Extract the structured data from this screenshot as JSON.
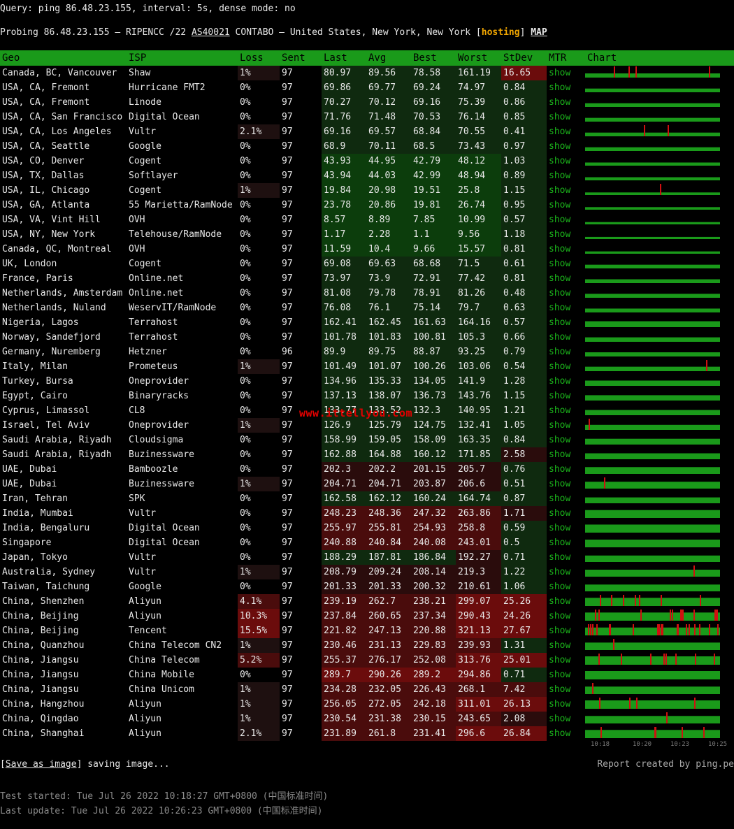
{
  "query_line": "Query: ping 86.48.23.155, interval: 5s, dense mode: no",
  "probe": {
    "prefix": "Probing 86.48.23.155 — RIPENCC /22 ",
    "asn": "AS40021",
    "middle": " CONTABO — United States, New York, New York [",
    "tag": "hosting",
    "end": "] ",
    "map": "MAP"
  },
  "headers": [
    "Geo",
    "ISP",
    "Loss",
    "Sent",
    "Last",
    "Avg",
    "Best",
    "Worst",
    "StDev",
    "MTR",
    "Chart"
  ],
  "rows": [
    [
      "Canada, BC, Vancouver",
      "Shaw",
      "1%",
      "97",
      "80.97",
      "89.56",
      "78.58",
      "161.19",
      "16.65",
      "show"
    ],
    [
      "USA, CA, Fremont",
      "Hurricane FMT2",
      "0%",
      "97",
      "69.86",
      "69.77",
      "69.24",
      "74.97",
      "0.84",
      "show"
    ],
    [
      "USA, CA, Fremont",
      "Linode",
      "0%",
      "97",
      "70.27",
      "70.12",
      "69.16",
      "75.39",
      "0.86",
      "show"
    ],
    [
      "USA, CA, San Francisco",
      "Digital Ocean",
      "0%",
      "97",
      "71.76",
      "71.48",
      "70.53",
      "76.14",
      "0.85",
      "show"
    ],
    [
      "USA, CA, Los Angeles",
      "Vultr",
      "2.1%",
      "97",
      "69.16",
      "69.57",
      "68.84",
      "70.55",
      "0.41",
      "show"
    ],
    [
      "USA, CA, Seattle",
      "Google",
      "0%",
      "97",
      "68.9",
      "70.11",
      "68.5",
      "73.43",
      "0.97",
      "show"
    ],
    [
      "USA, CO, Denver",
      "Cogent",
      "0%",
      "97",
      "43.93",
      "44.95",
      "42.79",
      "48.12",
      "1.03",
      "show"
    ],
    [
      "USA, TX, Dallas",
      "Softlayer",
      "0%",
      "97",
      "43.94",
      "44.03",
      "42.99",
      "48.94",
      "0.89",
      "show"
    ],
    [
      "USA, IL, Chicago",
      "Cogent",
      "1%",
      "97",
      "19.84",
      "20.98",
      "19.51",
      "25.8",
      "1.15",
      "show"
    ],
    [
      "USA, GA, Atlanta",
      "55 Marietta/RamNode",
      "0%",
      "97",
      "23.78",
      "20.86",
      "19.81",
      "26.74",
      "0.95",
      "show"
    ],
    [
      "USA, VA, Vint Hill",
      "OVH",
      "0%",
      "97",
      "8.57",
      "8.89",
      "7.85",
      "10.99",
      "0.57",
      "show"
    ],
    [
      "USA, NY, New York",
      "Telehouse/RamNode",
      "0%",
      "97",
      "1.17",
      "2.28",
      "1.1",
      "9.56",
      "1.18",
      "show"
    ],
    [
      "Canada, QC, Montreal",
      "OVH",
      "0%",
      "97",
      "11.59",
      "10.4",
      "9.66",
      "15.57",
      "0.81",
      "show"
    ],
    [
      "UK, London",
      "Cogent",
      "0%",
      "97",
      "69.08",
      "69.63",
      "68.68",
      "71.5",
      "0.61",
      "show"
    ],
    [
      "France, Paris",
      "Online.net",
      "0%",
      "97",
      "73.97",
      "73.9",
      "72.91",
      "77.42",
      "0.81",
      "show"
    ],
    [
      "Netherlands, Amsterdam",
      "Online.net",
      "0%",
      "97",
      "81.08",
      "79.78",
      "78.91",
      "81.26",
      "0.48",
      "show"
    ],
    [
      "Netherlands, Nuland",
      "WeservIT/RamNode",
      "0%",
      "97",
      "76.08",
      "76.1",
      "75.14",
      "79.7",
      "0.63",
      "show"
    ],
    [
      "Nigeria, Lagos",
      "Terrahost",
      "0%",
      "97",
      "162.41",
      "162.45",
      "161.63",
      "164.16",
      "0.57",
      "show"
    ],
    [
      "Norway, Sandefjord",
      "Terrahost",
      "0%",
      "97",
      "101.78",
      "101.83",
      "100.81",
      "105.3",
      "0.66",
      "show"
    ],
    [
      "Germany, Nuremberg",
      "Hetzner",
      "0%",
      "96",
      "89.9",
      "89.75",
      "88.87",
      "93.25",
      "0.79",
      "show"
    ],
    [
      "Italy, Milan",
      "Prometeus",
      "1%",
      "97",
      "101.49",
      "101.07",
      "100.26",
      "103.06",
      "0.54",
      "show"
    ],
    [
      "Turkey, Bursa",
      "Oneprovider",
      "0%",
      "97",
      "134.96",
      "135.33",
      "134.05",
      "141.9",
      "1.28",
      "show"
    ],
    [
      "Egypt, Cairo",
      "Binaryracks",
      "0%",
      "97",
      "137.13",
      "138.07",
      "136.73",
      "143.76",
      "1.15",
      "show"
    ],
    [
      "Cyprus, Limassol",
      "CL8",
      "0%",
      "97",
      "133.77",
      "133.52",
      "132.3",
      "140.95",
      "1.21",
      "show"
    ],
    [
      "Israel, Tel Aviv",
      "Oneprovider",
      "1%",
      "97",
      "126.9",
      "125.79",
      "124.75",
      "132.41",
      "1.05",
      "show"
    ],
    [
      "Saudi Arabia, Riyadh",
      "Cloudsigma",
      "0%",
      "97",
      "158.99",
      "159.05",
      "158.09",
      "163.35",
      "0.84",
      "show"
    ],
    [
      "Saudi Arabia, Riyadh",
      "Buzinessware",
      "0%",
      "97",
      "162.88",
      "164.88",
      "160.12",
      "171.85",
      "2.58",
      "show"
    ],
    [
      "UAE, Dubai",
      "Bamboozle",
      "0%",
      "97",
      "202.3",
      "202.2",
      "201.15",
      "205.7",
      "0.76",
      "show"
    ],
    [
      "UAE, Dubai",
      "Buzinessware",
      "1%",
      "97",
      "204.71",
      "204.71",
      "203.87",
      "206.6",
      "0.51",
      "show"
    ],
    [
      "Iran, Tehran",
      "SPK",
      "0%",
      "97",
      "162.58",
      "162.12",
      "160.24",
      "164.74",
      "0.87",
      "show"
    ],
    [
      "India, Mumbai",
      "Vultr",
      "0%",
      "97",
      "248.23",
      "248.36",
      "247.32",
      "263.86",
      "1.71",
      "show"
    ],
    [
      "India, Bengaluru",
      "Digital Ocean",
      "0%",
      "97",
      "255.97",
      "255.81",
      "254.93",
      "258.8",
      "0.59",
      "show"
    ],
    [
      "Singapore",
      "Digital Ocean",
      "0%",
      "97",
      "240.88",
      "240.84",
      "240.08",
      "243.01",
      "0.5",
      "show"
    ],
    [
      "Japan, Tokyo",
      "Vultr",
      "0%",
      "97",
      "188.29",
      "187.81",
      "186.84",
      "192.27",
      "0.71",
      "show"
    ],
    [
      "Australia, Sydney",
      "Vultr",
      "1%",
      "97",
      "208.79",
      "209.24",
      "208.14",
      "219.3",
      "1.22",
      "show"
    ],
    [
      "Taiwan, Taichung",
      "Google",
      "0%",
      "97",
      "201.33",
      "201.33",
      "200.32",
      "210.61",
      "1.06",
      "show"
    ],
    [
      "China, Shenzhen",
      "Aliyun",
      "4.1%",
      "97",
      "239.19",
      "262.7",
      "238.21",
      "299.07",
      "25.26",
      "show"
    ],
    [
      "China, Beijing",
      "Aliyun",
      "10.3%",
      "97",
      "237.84",
      "260.65",
      "237.34",
      "290.43",
      "24.26",
      "show"
    ],
    [
      "China, Beijing",
      "Tencent",
      "15.5%",
      "97",
      "221.82",
      "247.13",
      "220.88",
      "321.13",
      "27.67",
      "show"
    ],
    [
      "China, Quanzhou",
      "China Telecom CN2",
      "1%",
      "97",
      "230.46",
      "231.13",
      "229.83",
      "239.93",
      "1.31",
      "show"
    ],
    [
      "China, Jiangsu",
      "China Telecom",
      "5.2%",
      "97",
      "255.37",
      "276.17",
      "252.08",
      "313.76",
      "25.01",
      "show"
    ],
    [
      "China, Jiangsu",
      "China Mobile",
      "0%",
      "97",
      "289.7",
      "290.26",
      "289.2",
      "294.86",
      "0.71",
      "show"
    ],
    [
      "China, Jiangsu",
      "China Unicom",
      "1%",
      "97",
      "234.28",
      "232.05",
      "226.43",
      "268.1",
      "7.42",
      "show"
    ],
    [
      "China, Hangzhou",
      "Aliyun",
      "1%",
      "97",
      "256.05",
      "272.05",
      "242.18",
      "311.01",
      "26.13",
      "show"
    ],
    [
      "China, Qingdao",
      "Aliyun",
      "1%",
      "97",
      "230.54",
      "231.38",
      "230.15",
      "243.65",
      "2.08",
      "show"
    ],
    [
      "China, Shanghai",
      "Aliyun",
      "2.1%",
      "97",
      "231.89",
      "261.8",
      "231.41",
      "296.6",
      "26.84",
      "show"
    ]
  ],
  "chart_axis": [
    "10:18",
    "10:20",
    "10:23",
    "10:25"
  ],
  "watermark": "www.ittellyou.com",
  "save_link": "Save as image",
  "saving_text": "saving image...",
  "report": "Report created by ping.pe",
  "test_started": "Test started: Tue Jul 26 2022 10:18:27 GMT+0800 (中国标准时间)",
  "last_update": "Last update: Tue Jul 26 2022 10:26:23 GMT+0800 (中国标准时间)",
  "colors": {
    "header_green": "#1a9a1a",
    "bar_green": "#1a9a1a",
    "spike_red": "#d01010",
    "hosting": "#f0a500"
  }
}
